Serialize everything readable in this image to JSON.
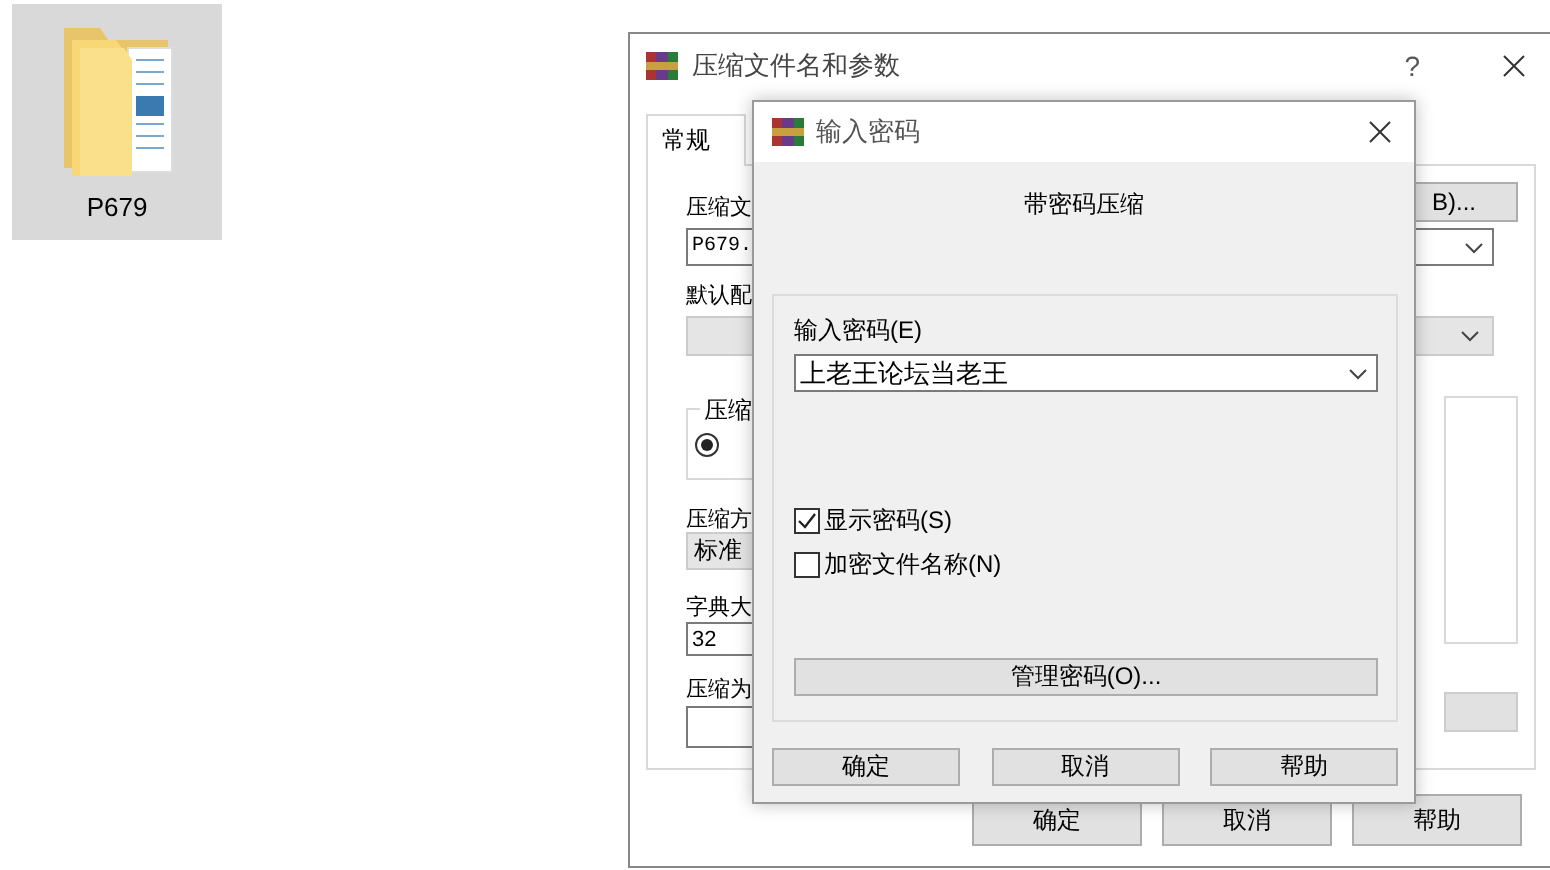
{
  "desktop_item": {
    "label": "P679",
    "selected": true
  },
  "archive_window": {
    "title": "压缩文件名和参数",
    "help": "?",
    "tabs": [
      {
        "label": "常规",
        "selected": true
      }
    ],
    "archive_name_label": "压缩文",
    "browse_button": "B)...",
    "archive_name": "P679.",
    "profile_label": "默认配",
    "group_legend": "压缩",
    "radio_selected": true,
    "method_label": "压缩方",
    "method": "标准",
    "dictionary_label": "字典大",
    "dictionary": "32",
    "split_label": "压缩为",
    "buttons": [
      "确定",
      "取消",
      "帮助"
    ]
  },
  "password_dialog": {
    "title": "输入密码",
    "heading": "带密码压缩",
    "password_label": "输入密码(E)",
    "password": "上老王论坛当老王",
    "options": [
      {
        "label": "显示密码(S)",
        "checked": true
      },
      {
        "label": "加密文件名称(N)",
        "checked": false
      }
    ],
    "manage_button": "管理密码(O)...",
    "buttons": [
      "确定",
      "取消",
      "帮助"
    ]
  }
}
